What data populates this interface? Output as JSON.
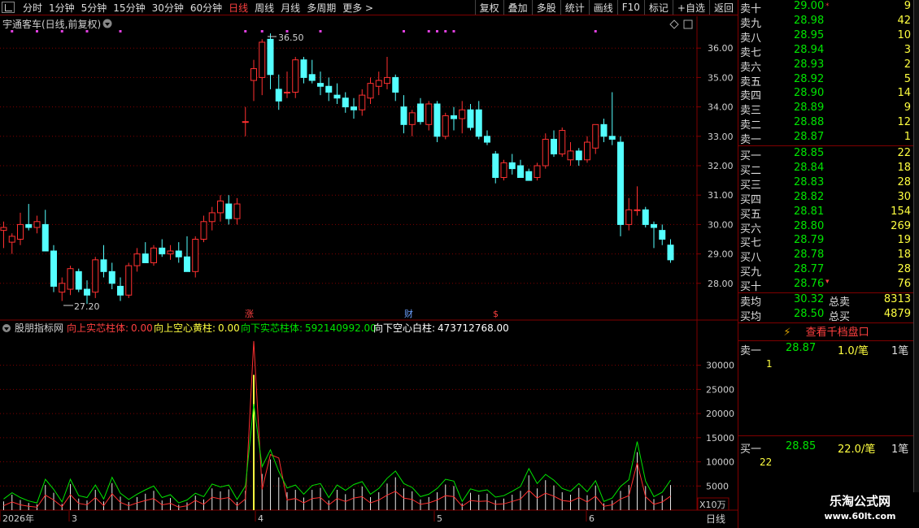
{
  "toolbar": {
    "timeframes": [
      "分时",
      "1分钟",
      "5分钟",
      "15分钟",
      "30分钟",
      "60分钟",
      "日线",
      "周线",
      "月线",
      "多周期",
      "更多 >"
    ],
    "active_index": 6,
    "tools": [
      "复权",
      "叠加",
      "多股",
      "统计",
      "画线",
      "F10",
      "标记",
      "+自选",
      "返回"
    ]
  },
  "main_chart": {
    "title": "宇通客车(日线,前复权)",
    "high_label": "36.50",
    "low_label": "27.20",
    "event_markers": [
      "涨",
      "财",
      "$"
    ],
    "y_ticks": [
      28.0,
      29.0,
      30.0,
      31.0,
      32.0,
      33.0,
      34.0,
      35.0,
      36.0
    ],
    "y_range": [
      27.0,
      37.0
    ]
  },
  "indicator": {
    "name": "股朋指标网",
    "items": [
      {
        "label": "向上实芯柱体:",
        "value": "0.00",
        "color": "#ff4040"
      },
      {
        "label": "向上空心黄柱:",
        "value": "0.00",
        "color": "#ffff40"
      },
      {
        "label": "向下实芯柱体:",
        "value": "592140992.00",
        "color": "#00e400"
      },
      {
        "label": "向下空心白柱:",
        "value": "473712768.00",
        "color": "#ffffff"
      }
    ],
    "y_ticks": [
      5000,
      10000,
      15000,
      20000,
      25000,
      30000
    ],
    "unit_label": "X10万",
    "y_range": [
      0,
      36000
    ]
  },
  "time_axis": {
    "labels": [
      "2026年",
      "3",
      "4",
      "5",
      "6"
    ],
    "period_label": "日线"
  },
  "colors": {
    "up": "#ff3030",
    "down": "#54ffff",
    "grid": "#800000",
    "text": "#d0d0d0",
    "ma_green": "#00e400",
    "ma_yellow": "#ffff40"
  },
  "chart_data": {
    "type": "candlestick",
    "bars": [
      {
        "o": 29.8,
        "h": 30.1,
        "l": 29.2,
        "c": 29.9
      },
      {
        "o": 29.4,
        "h": 29.7,
        "l": 29.0,
        "c": 29.6
      },
      {
        "o": 29.5,
        "h": 30.4,
        "l": 29.3,
        "c": 30.0
      },
      {
        "o": 30.0,
        "h": 30.7,
        "l": 29.8,
        "c": 29.9
      },
      {
        "o": 29.9,
        "h": 30.3,
        "l": 29.7,
        "c": 30.1
      },
      {
        "o": 30.0,
        "h": 30.5,
        "l": 29.2,
        "c": 29.1
      },
      {
        "o": 29.1,
        "h": 29.3,
        "l": 27.7,
        "c": 27.9
      },
      {
        "o": 27.7,
        "h": 28.2,
        "l": 27.4,
        "c": 28.0
      },
      {
        "o": 27.8,
        "h": 28.6,
        "l": 27.6,
        "c": 28.5
      },
      {
        "o": 28.4,
        "h": 28.5,
        "l": 27.7,
        "c": 27.8
      },
      {
        "o": 27.8,
        "h": 28.1,
        "l": 27.3,
        "c": 27.6
      },
      {
        "o": 27.7,
        "h": 28.9,
        "l": 27.5,
        "c": 28.8
      },
      {
        "o": 28.8,
        "h": 29.3,
        "l": 28.2,
        "c": 28.4
      },
      {
        "o": 28.4,
        "h": 28.7,
        "l": 27.8,
        "c": 28.0
      },
      {
        "o": 27.9,
        "h": 28.2,
        "l": 27.4,
        "c": 27.6
      },
      {
        "o": 27.6,
        "h": 28.7,
        "l": 27.5,
        "c": 28.6
      },
      {
        "o": 28.6,
        "h": 29.2,
        "l": 28.4,
        "c": 29.0
      },
      {
        "o": 29.0,
        "h": 29.4,
        "l": 28.8,
        "c": 28.7
      },
      {
        "o": 28.7,
        "h": 29.3,
        "l": 28.6,
        "c": 29.2
      },
      {
        "o": 29.2,
        "h": 29.5,
        "l": 28.9,
        "c": 29.0
      },
      {
        "o": 29.0,
        "h": 29.3,
        "l": 28.8,
        "c": 29.1
      },
      {
        "o": 29.1,
        "h": 29.4,
        "l": 28.7,
        "c": 28.9
      },
      {
        "o": 28.9,
        "h": 29.6,
        "l": 28.5,
        "c": 28.4
      },
      {
        "o": 28.4,
        "h": 29.6,
        "l": 28.2,
        "c": 29.5
      },
      {
        "o": 29.5,
        "h": 30.3,
        "l": 29.4,
        "c": 30.1
      },
      {
        "o": 30.1,
        "h": 30.6,
        "l": 29.8,
        "c": 30.4
      },
      {
        "o": 30.4,
        "h": 31.0,
        "l": 30.1,
        "c": 30.8
      },
      {
        "o": 30.7,
        "h": 31.0,
        "l": 30.0,
        "c": 30.2
      },
      {
        "o": 30.2,
        "h": 30.9,
        "l": 30.0,
        "c": 30.7
      },
      {
        "o": 33.5,
        "h": 34.0,
        "l": 33.0,
        "c": 33.5
      },
      {
        "o": 34.9,
        "h": 35.6,
        "l": 34.2,
        "c": 35.3
      },
      {
        "o": 35.0,
        "h": 36.3,
        "l": 34.4,
        "c": 36.2
      },
      {
        "o": 36.3,
        "h": 36.5,
        "l": 34.6,
        "c": 35.1
      },
      {
        "o": 34.6,
        "h": 35.1,
        "l": 33.9,
        "c": 34.2
      },
      {
        "o": 34.5,
        "h": 35.2,
        "l": 34.3,
        "c": 34.5
      },
      {
        "o": 34.5,
        "h": 35.7,
        "l": 34.3,
        "c": 35.6
      },
      {
        "o": 35.6,
        "h": 35.7,
        "l": 34.8,
        "c": 35.0
      },
      {
        "o": 35.1,
        "h": 35.6,
        "l": 34.8,
        "c": 34.9
      },
      {
        "o": 34.8,
        "h": 35.2,
        "l": 34.4,
        "c": 34.7
      },
      {
        "o": 34.7,
        "h": 35.0,
        "l": 34.2,
        "c": 34.5
      },
      {
        "o": 34.4,
        "h": 34.8,
        "l": 34.1,
        "c": 34.3
      },
      {
        "o": 34.3,
        "h": 34.5,
        "l": 33.8,
        "c": 34.0
      },
      {
        "o": 34.0,
        "h": 34.3,
        "l": 33.6,
        "c": 33.9
      },
      {
        "o": 33.9,
        "h": 34.6,
        "l": 33.7,
        "c": 34.4
      },
      {
        "o": 34.3,
        "h": 35.0,
        "l": 34.1,
        "c": 34.8
      },
      {
        "o": 34.7,
        "h": 35.2,
        "l": 34.4,
        "c": 34.9
      },
      {
        "o": 34.8,
        "h": 35.7,
        "l": 34.6,
        "c": 35.0
      },
      {
        "o": 35.0,
        "h": 35.1,
        "l": 34.2,
        "c": 34.5
      },
      {
        "o": 34.0,
        "h": 34.4,
        "l": 33.1,
        "c": 33.4
      },
      {
        "o": 33.4,
        "h": 33.9,
        "l": 33.0,
        "c": 33.8
      },
      {
        "o": 34.1,
        "h": 34.3,
        "l": 33.4,
        "c": 33.5
      },
      {
        "o": 33.4,
        "h": 34.2,
        "l": 33.2,
        "c": 34.1
      },
      {
        "o": 34.1,
        "h": 34.2,
        "l": 32.8,
        "c": 33.0
      },
      {
        "o": 33.0,
        "h": 33.8,
        "l": 32.9,
        "c": 33.7
      },
      {
        "o": 33.7,
        "h": 34.0,
        "l": 33.2,
        "c": 33.6
      },
      {
        "o": 33.6,
        "h": 34.2,
        "l": 33.1,
        "c": 33.9
      },
      {
        "o": 33.9,
        "h": 34.1,
        "l": 33.2,
        "c": 33.3
      },
      {
        "o": 33.9,
        "h": 34.2,
        "l": 32.9,
        "c": 33.0
      },
      {
        "o": 33.0,
        "h": 33.2,
        "l": 32.7,
        "c": 32.8
      },
      {
        "o": 32.4,
        "h": 32.5,
        "l": 31.4,
        "c": 31.6
      },
      {
        "o": 31.6,
        "h": 32.2,
        "l": 31.5,
        "c": 32.1
      },
      {
        "o": 32.1,
        "h": 32.4,
        "l": 31.7,
        "c": 31.9
      },
      {
        "o": 32.0,
        "h": 32.2,
        "l": 31.6,
        "c": 31.6
      },
      {
        "o": 31.8,
        "h": 31.9,
        "l": 31.5,
        "c": 31.5
      },
      {
        "o": 31.6,
        "h": 32.1,
        "l": 31.5,
        "c": 32.0
      },
      {
        "o": 32.0,
        "h": 33.1,
        "l": 31.9,
        "c": 32.9
      },
      {
        "o": 32.9,
        "h": 33.2,
        "l": 32.3,
        "c": 32.4
      },
      {
        "o": 32.4,
        "h": 33.3,
        "l": 32.3,
        "c": 33.2
      },
      {
        "o": 32.2,
        "h": 32.8,
        "l": 32.0,
        "c": 32.5
      },
      {
        "o": 32.5,
        "h": 32.6,
        "l": 32.0,
        "c": 32.2
      },
      {
        "o": 32.2,
        "h": 33.0,
        "l": 32.1,
        "c": 32.8
      },
      {
        "o": 32.6,
        "h": 33.4,
        "l": 32.4,
        "c": 33.4
      },
      {
        "o": 33.4,
        "h": 33.6,
        "l": 32.8,
        "c": 33.0
      },
      {
        "o": 33.0,
        "h": 34.5,
        "l": 32.7,
        "c": 32.9
      },
      {
        "o": 32.8,
        "h": 33.0,
        "l": 29.6,
        "c": 30.0
      },
      {
        "o": 30.0,
        "h": 30.9,
        "l": 29.8,
        "c": 30.5
      },
      {
        "o": 30.5,
        "h": 31.3,
        "l": 30.3,
        "c": 30.5
      },
      {
        "o": 30.5,
        "h": 30.6,
        "l": 29.9,
        "c": 30.0
      },
      {
        "o": 30.0,
        "h": 30.1,
        "l": 29.2,
        "c": 29.9
      },
      {
        "o": 29.8,
        "h": 30.0,
        "l": 29.3,
        "c": 29.5
      },
      {
        "o": 29.3,
        "h": 29.5,
        "l": 28.7,
        "c": 28.8
      }
    ],
    "indicator_series": {
      "green": [
        2300,
        3600,
        2600,
        1900,
        1500,
        6400,
        4300,
        1700,
        6400,
        3000,
        2600,
        5200,
        2300,
        6800,
        3500,
        2200,
        3300,
        4200,
        5000,
        2600,
        3200,
        1500,
        2100,
        3500,
        2800,
        5400,
        4800,
        5200,
        2200,
        5000,
        22000,
        9000,
        12500,
        8000,
        4600,
        5200,
        3300,
        5100,
        5500,
        2600,
        5200,
        4100,
        5300,
        5900,
        3300,
        4500,
        6600,
        8100,
        5500,
        4700,
        2800,
        3300,
        4500,
        6400,
        6000,
        1800,
        4400,
        3900,
        4200,
        2700,
        3000,
        3900,
        4900,
        8600,
        5500,
        7400,
        6200,
        4500,
        3900,
        5500,
        3800,
        6100,
        1800,
        2500,
        4900,
        6300,
        14200,
        6000,
        2800,
        3700,
        6200
      ],
      "red": [
        900,
        1700,
        1100,
        800,
        600,
        3100,
        2100,
        700,
        3200,
        1400,
        1100,
        2600,
        900,
        3400,
        1600,
        900,
        1500,
        2000,
        2400,
        1100,
        1400,
        600,
        900,
        2000,
        1200,
        2700,
        2300,
        2600,
        900,
        2300,
        35000,
        4300,
        11500,
        10800,
        2100,
        2400,
        1500,
        2400,
        2600,
        1100,
        2400,
        1800,
        2500,
        2800,
        1500,
        2100,
        3100,
        3900,
        2500,
        2200,
        1200,
        1500,
        2100,
        3000,
        2800,
        800,
        2000,
        1800,
        1900,
        1200,
        1300,
        1800,
        2300,
        4100,
        2500,
        3500,
        2900,
        2000,
        1800,
        2600,
        1700,
        2900,
        800,
        1100,
        2300,
        3000,
        9800,
        2800,
        1200,
        1700,
        2900
      ],
      "white_bars": [
        1800,
        3200,
        2100,
        1500,
        1200,
        5200,
        3600,
        1300,
        5400,
        2400,
        2000,
        4200,
        1800,
        5600,
        2800,
        1700,
        2700,
        3400,
        4000,
        2000,
        2500,
        1100,
        1600,
        3000,
        2200,
        4500,
        3900,
        4300,
        1700,
        4000,
        0,
        7500,
        10500,
        6800,
        3700,
        4200,
        2600,
        4200,
        4600,
        2000,
        4200,
        3300,
        4400,
        4900,
        2700,
        3700,
        5500,
        6800,
        4500,
        3900,
        2200,
        2700,
        3700,
        5300,
        5000,
        1400,
        3600,
        3200,
        3400,
        2100,
        2400,
        3200,
        4000,
        7200,
        4500,
        6200,
        5100,
        3700,
        3200,
        4600,
        3100,
        5100,
        1400,
        2000,
        4000,
        5200,
        12000,
        5000,
        2300,
        3000,
        5200
      ],
      "yellow_spike_index": 30,
      "yellow_spike_value": 28000
    }
  },
  "quote_panel": {
    "asks": [
      {
        "label": "卖十",
        "price": "29.00",
        "vol": "9",
        "mark": "⁎"
      },
      {
        "label": "卖九",
        "price": "28.98",
        "vol": "42",
        "mark": ""
      },
      {
        "label": "卖八",
        "price": "28.95",
        "vol": "10",
        "mark": ""
      },
      {
        "label": "卖七",
        "price": "28.94",
        "vol": "3",
        "mark": ""
      },
      {
        "label": "卖六",
        "price": "28.93",
        "vol": "2",
        "mark": ""
      },
      {
        "label": "卖五",
        "price": "28.92",
        "vol": "5",
        "mark": ""
      },
      {
        "label": "卖四",
        "price": "28.90",
        "vol": "14",
        "mark": ""
      },
      {
        "label": "卖三",
        "price": "28.89",
        "vol": "9",
        "mark": ""
      },
      {
        "label": "卖二",
        "price": "28.88",
        "vol": "12",
        "mark": ""
      },
      {
        "label": "卖一",
        "price": "28.87",
        "vol": "1",
        "mark": ""
      }
    ],
    "bids": [
      {
        "label": "买一",
        "price": "28.85",
        "vol": "22",
        "mark": ""
      },
      {
        "label": "买二",
        "price": "28.84",
        "vol": "18",
        "mark": ""
      },
      {
        "label": "买三",
        "price": "28.83",
        "vol": "28",
        "mark": ""
      },
      {
        "label": "买四",
        "price": "28.82",
        "vol": "30",
        "mark": ""
      },
      {
        "label": "买五",
        "price": "28.81",
        "vol": "154",
        "mark": ""
      },
      {
        "label": "买六",
        "price": "28.80",
        "vol": "269",
        "mark": ""
      },
      {
        "label": "买七",
        "price": "28.79",
        "vol": "19",
        "mark": ""
      },
      {
        "label": "买八",
        "price": "28.78",
        "vol": "18",
        "mark": ""
      },
      {
        "label": "买九",
        "price": "28.77",
        "vol": "28",
        "mark": ""
      },
      {
        "label": "买十",
        "price": "28.76",
        "vol": "76",
        "mark": "▾"
      }
    ],
    "ask_avg": {
      "label": "卖均",
      "price": "30.32",
      "total_label": "总卖",
      "total": "8313"
    },
    "bid_avg": {
      "label": "买均",
      "price": "28.50",
      "total_label": "总买",
      "total": "4879"
    },
    "detail_button": "查看千档盘口",
    "ask1_detail": {
      "label": "卖一",
      "price": "28.87",
      "size": "1.0/笔",
      "count": "1笔",
      "queue": "1"
    },
    "bid1_detail": {
      "label": "买一",
      "price": "28.85",
      "size": "22.0/笔",
      "count": "1笔",
      "queue": "22"
    }
  },
  "watermark": {
    "line1": "乐淘公式网",
    "line2": "www.60lt.com"
  }
}
